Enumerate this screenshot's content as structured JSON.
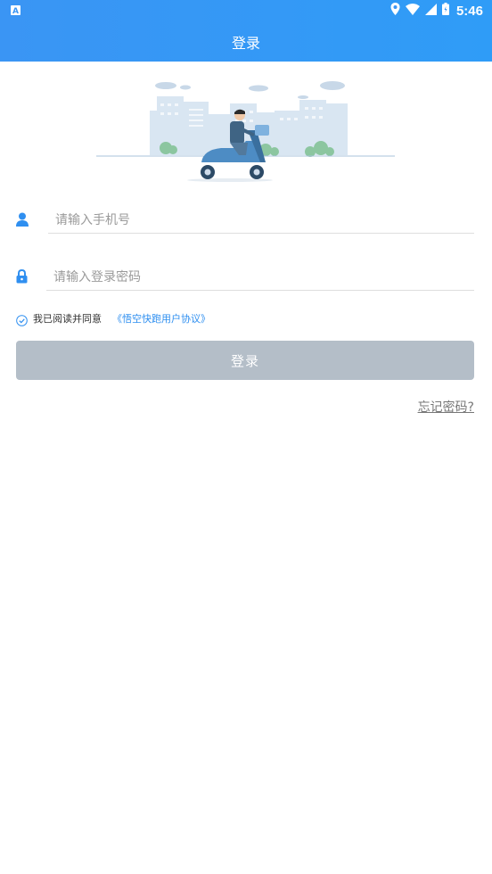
{
  "status_bar": {
    "time": "5:46",
    "icons": [
      "notification-a-icon",
      "location-icon",
      "wifi-icon",
      "cellular-icon",
      "battery-icon"
    ]
  },
  "header": {
    "title": "登录"
  },
  "illustration": {
    "description_icon": "delivery-scooter-illustration"
  },
  "form": {
    "phone_placeholder": "请输入手机号",
    "phone_value": "",
    "password_placeholder": "请输入登录密码",
    "password_value": "",
    "agree_text": "我已阅读并同意",
    "agreement_link": "《悟空快跑用户协议》",
    "agree_checked": true,
    "login_label": "登录",
    "forgot_label": "忘记密码?"
  },
  "colors": {
    "primary": "#3a95f4",
    "link": "#2f8ff0",
    "button_disabled": "#b4bec8",
    "icon_blue": "#2f8ff0"
  }
}
